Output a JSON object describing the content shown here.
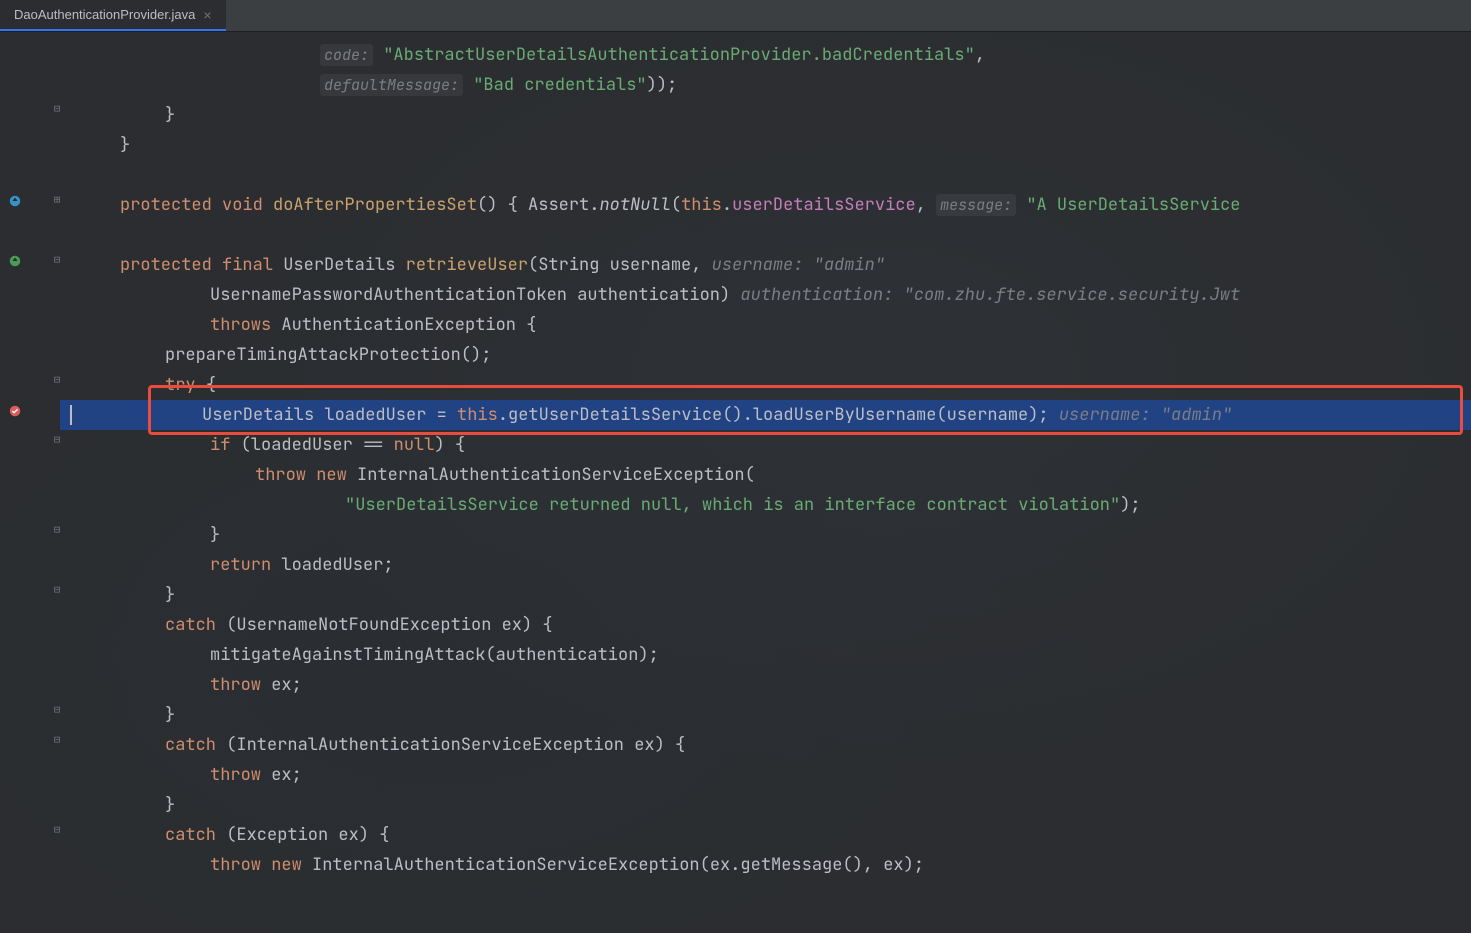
{
  "tab": {
    "title": "DaoAuthenticationProvider.java",
    "close": "×"
  },
  "code": {
    "l1_code": "code:",
    "l1_str": "\"AbstractUserDetailsAuthenticationProvider.badCredentials\"",
    "l1_comma": ",",
    "l2_hint": "defaultMessage:",
    "l2_str": "\"Bad credentials\"",
    "l2_end": "));",
    "l3": "}",
    "l4": "}",
    "l5_protected": "protected",
    "l5_void": "void",
    "l5_method": "doAfterPropertiesSet",
    "l5_paren": "() {",
    "l5_assert": "Assert",
    "l5_dot": ".",
    "l5_notNull": "notNull",
    "l5_lparen": "(",
    "l5_this": "this",
    "l5_dot2": ".",
    "l5_field": "userDetailsService",
    "l5_comma": ",",
    "l5_msg_hint": "message:",
    "l5_str": "\"A UserDetailsService",
    "l6_protected": "protected",
    "l6_final": "final",
    "l6_type": "UserDetails",
    "l6_method": "retrieveUser",
    "l6_lparen": "(String username,",
    "l6_hint": "username: \"admin\"",
    "l7_param": "UsernamePasswordAuthenticationToken authentication)",
    "l7_hint": "authentication: \"com.zhu.fte.service.security.Jwt",
    "l8_throws": "throws",
    "l8_exc": "AuthenticationException {",
    "l9": "prepareTimingAttackProtection();",
    "l10_try": "try",
    "l10_brace": "{",
    "l11_type": "UserDetails",
    "l11_var": "loadedUser =",
    "l11_this": "this",
    "l11_call": ".getUserDetailsService().loadUserByUsername(username);",
    "l11_hint": "username: \"admin\"",
    "l12_if": "if",
    "l12_cond": "(loadedUser ==",
    "l12_null": "null",
    "l12_end": ") {",
    "l13_throw": "throw",
    "l13_new": "new",
    "l13_exc": "InternalAuthenticationServiceException(",
    "l14_str": "\"UserDetailsService returned null, which is an interface contract violation\"",
    "l14_end": ");",
    "l15": "}",
    "l16_return": "return",
    "l16_var": "loadedUser;",
    "l17": "}",
    "l18_catch": "catch",
    "l18_exc": "(UsernameNotFoundException ex) {",
    "l19": "mitigateAgainstTimingAttack(authentication);",
    "l20_throw": "throw",
    "l20_var": "ex;",
    "l21": "}",
    "l22_catch": "catch",
    "l22_exc": "(InternalAuthenticationServiceException ex) {",
    "l23_throw": "throw",
    "l23_var": "ex;",
    "l24": "}",
    "l25_catch": "catch",
    "l25_exc": "(Exception ex) {",
    "l26_throw": "throw",
    "l26_new": "new",
    "l26_call": "InternalAuthenticationServiceException(ex.getMessage(), ex);"
  }
}
